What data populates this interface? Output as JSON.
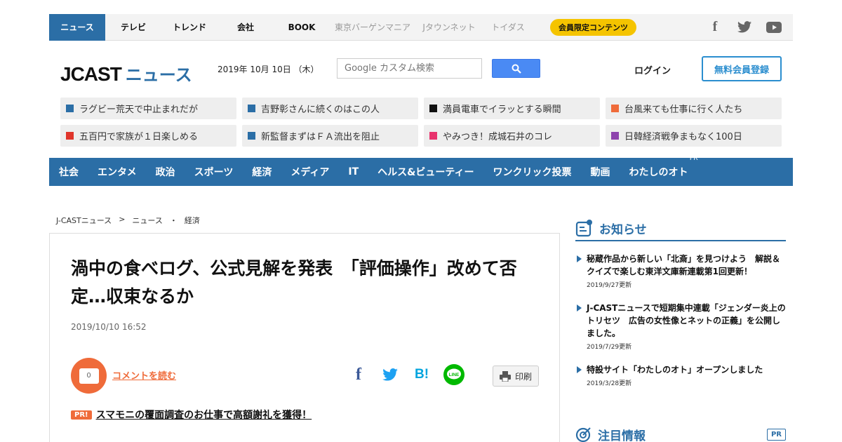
{
  "topbar": {
    "items": [
      {
        "label": "ニュース",
        "active": true
      },
      {
        "label": "テレビ"
      },
      {
        "label": "トレンド"
      },
      {
        "label": "会社"
      },
      {
        "label": "BOOK"
      },
      {
        "label": "東京バーゲンマニア",
        "sub": true
      },
      {
        "label": "Jタウンネット",
        "sub": true
      },
      {
        "label": "トイダス",
        "sub": true
      }
    ],
    "badge": "会員限定コンテンツ",
    "social": {
      "facebook": "f",
      "twitter": "🐦",
      "youtube": "▶"
    }
  },
  "header": {
    "logo_jcast": "JCAST",
    "logo_news": "ニュース",
    "date": "2019年 10月 10日 （木）",
    "search_placeholder": "Google カスタム検索",
    "login": "ログイン",
    "register": "無料会員登録"
  },
  "trending": [
    {
      "label": "ラグビー荒天で中止まれだが",
      "color": "#2b6ea6"
    },
    {
      "label": "吉野彰さんに続くのはこの人",
      "color": "#2b6ea6"
    },
    {
      "label": "満員電車でイラッとする瞬間",
      "color": "#111111"
    },
    {
      "label": "台風来ても仕事に行く人たち",
      "color": "#ef6b3a"
    },
    {
      "label": "五百円で家族が１日楽しめる",
      "color": "#e0352b"
    },
    {
      "label": "新監督まずはＦＡ流出を阻止",
      "color": "#2b6ea6"
    },
    {
      "label": "やみつき！成城石井のコレ",
      "color": "#e8336d"
    },
    {
      "label": "日韓経済戦争まもなく100日",
      "color": "#8e44ad"
    }
  ],
  "categories": [
    "社会",
    "エンタメ",
    "政治",
    "スポーツ",
    "経済",
    "メディア",
    "IT",
    "ヘルス&ビューティー",
    "ワンクリック投票",
    "動画",
    "わたしのオト"
  ],
  "category_pr": "PR",
  "breadcrumb": [
    "J-CASTニュース",
    ">",
    "ニュース",
    "・",
    "経済"
  ],
  "article": {
    "title": "渦中の食べログ、公式見解を発表　「評価操作」改めて否定…収束なるか",
    "date": "2019/10/10 16:52",
    "comment_count": "0",
    "comment_link": "コメントを読む",
    "share": {
      "facebook": "f",
      "twitter": "t",
      "hatena": "B!",
      "line": "LINE"
    },
    "print": "印刷",
    "pr_badge": "PR!",
    "pr_text": "スマモニの覆面調査のお仕事で高額謝礼を獲得！"
  },
  "sidebar": {
    "notice_heading": "お知らせ",
    "notices": [
      {
        "text": "秘蔵作品から新しい「北斎」を見つけよう　解説＆クイズで楽しむ東洋文庫新連載第1回更新！",
        "date": "2019/9/27更新"
      },
      {
        "text": "J-CASTニュースで短期集中連載「ジェンダー炎上のトリセツ　広告の女性像とネットの正義」を公開しました。",
        "date": "2019/7/29更新"
      },
      {
        "text": "特設サイト「わたしのオト」オープンしました",
        "date": "2019/3/28更新"
      }
    ],
    "attention_heading": "注目情報",
    "attention_pr": "PR"
  }
}
